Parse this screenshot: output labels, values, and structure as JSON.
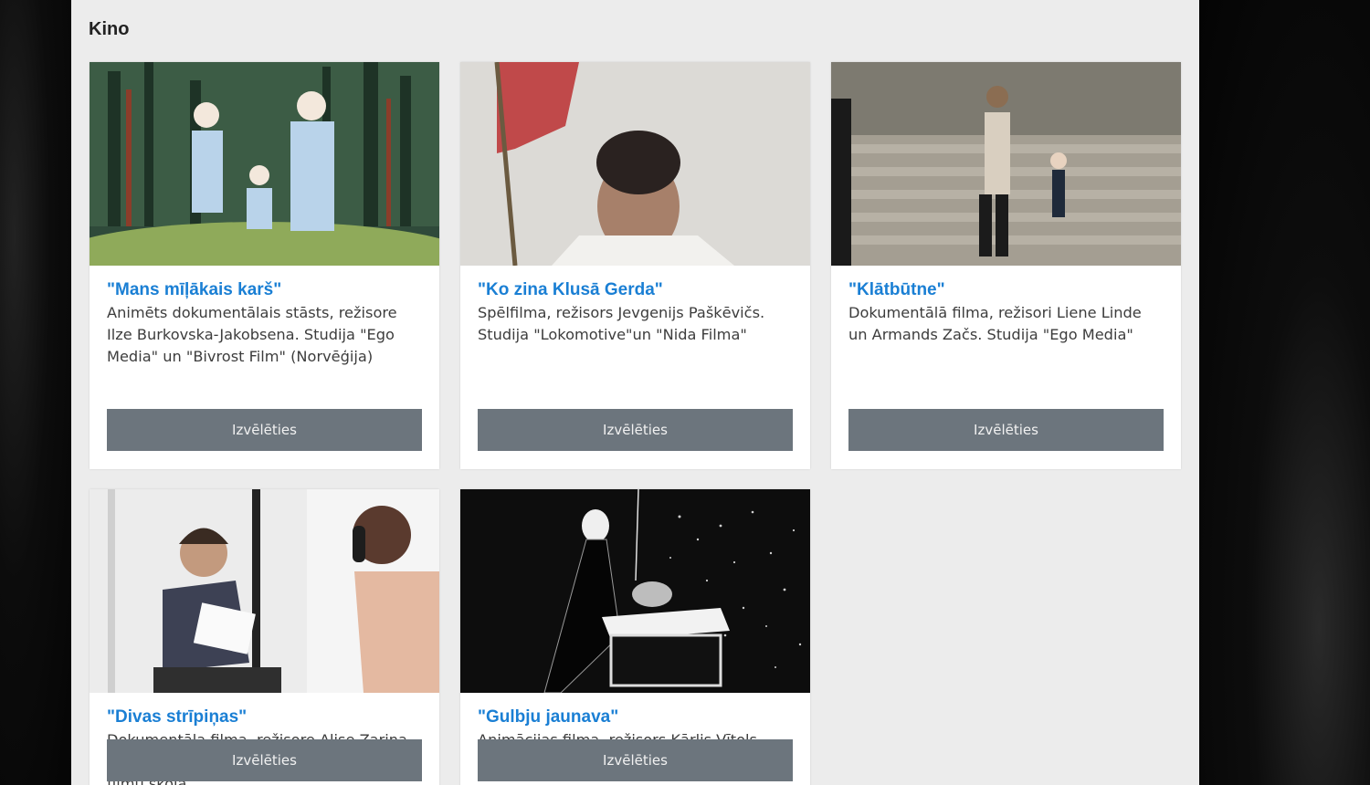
{
  "section": {
    "title": "Kino"
  },
  "cards": [
    {
      "title": "\"Mans mīļākais karš\"",
      "description": "Animēts dokumentālais stāsts, režisore Ilze Burkovska-Jakobsena. Studija \"Ego Media\" un \"Bivrost Film\" (Norvēģija)",
      "button": "Izvēlēties"
    },
    {
      "title": "\"Ko zina Klusā Gerda\"",
      "description": "Spēlfilma, režisors Jevgenijs Paškēvičs. Studija \"Lokomotive\"un \"Nida Filma\"",
      "button": "Izvēlēties"
    },
    {
      "title": "\"Klātbūtne\"",
      "description": "Dokumentālā filma, režisori Liene Linde un Armands Začs. Studija \"Ego Media\"",
      "button": "Izvēlēties"
    },
    {
      "title": "\"Divas strīpiņas\"",
      "description": "Dokumentāla filma, režisore Alise Zariņa. Latvijas Kultūras akadēmijas Nacionālā filmu skola",
      "button": "Izvēlēties"
    },
    {
      "title": "\"Gulbju jaunava\"",
      "description": "Animācijas filma, režisors Kārlis Vītols. Studija \"Air Productions\"",
      "button": "Izvēlēties"
    }
  ],
  "colors": {
    "link": "#1a7fd4",
    "button": "#6c757d",
    "panel": "#ececec",
    "background": "#0b0b0b"
  }
}
